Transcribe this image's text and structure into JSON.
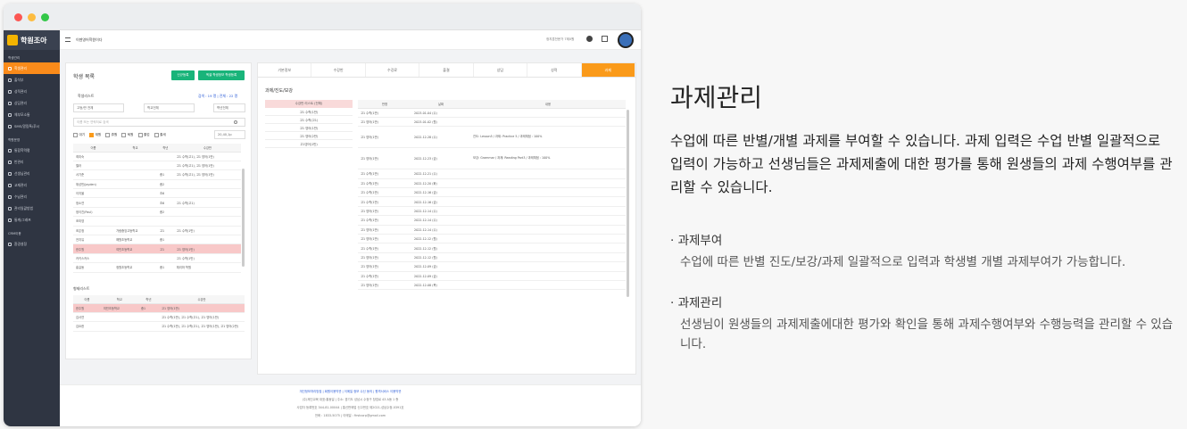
{
  "app": {
    "logo": "학원조아",
    "academy_name": "이젠영어학원이다",
    "top_right": "정지훈전문가 7제0원"
  },
  "sidebar": {
    "sections": [
      {
        "title": "학생관리",
        "items": [
          "학생관리",
          "출석부",
          "성적관리",
          "상담관리",
          "체부모소통",
          "SMS/알림톡/푸시"
        ]
      },
      {
        "title": "학원운영",
        "items": [
          "통합학력평",
          "반관리",
          "선생님관리",
          "교재관리",
          "수납관리",
          "관리일괄방법",
          "통계/그래프"
        ]
      },
      {
        "title": "CRM이용",
        "items": [
          "환경설정"
        ]
      }
    ]
  },
  "student_list": {
    "title": "학생 목록",
    "btn_new": "신규등록",
    "btn_bulk": "엑셀 학생정보 학생등록",
    "subtitle": "학생리스트",
    "count": "검색 : 19 명 | 전체 : 22 명",
    "filter1": "고등/반 전체",
    "filter2": "학교전체",
    "filter3": "학년전체",
    "search_placeholder": "이름 또는 연락처로 검색",
    "checks": [
      "대기",
      "재원",
      "휴원",
      "퇴원",
      "졸업",
      "졸세"
    ],
    "page_size": "20,40,1p",
    "headers": [
      "이름",
      "학교",
      "학년",
      "수강반"
    ],
    "rows": [
      [
        "최미숙",
        "",
        "",
        "고1 수학(고1), 고1 영어(1반)"
      ],
      [
        "엘라",
        "",
        "",
        "고1 수학(고1), 고1 영어(1반)"
      ],
      [
        "서기준",
        "",
        "중1",
        "고1 수학(고1), 고1 영어(1반)"
      ],
      [
        "위성민(Jayden)",
        "",
        "중2",
        ""
      ],
      [
        "이지을",
        "",
        "초6",
        ""
      ],
      [
        "정소연",
        "",
        "초6",
        "고1 수학(고1)"
      ],
      [
        "정이진(Paul)",
        "",
        "중2",
        ""
      ],
      [
        "조미영",
        "",
        "",
        ""
      ],
      [
        "조은정",
        "가람중앙고등학교",
        "고1",
        "고1 수학(1반)"
      ],
      [
        "전지유",
        "해원초등학교",
        "중1",
        ""
      ],
      [
        "한주원",
        "여민초등학교",
        "고1",
        "고1 영어(1반)"
      ],
      [
        "카키스카스",
        "",
        "",
        "고1 수학(1반)"
      ],
      [
        "홍길동",
        "정원초등학교",
        "중1",
        "체리마 학원"
      ]
    ],
    "highlight_row": 10
  },
  "wait_list": {
    "title": "형제리스트",
    "headers": [
      "이름",
      "학교",
      "학년",
      "수강반"
    ],
    "rows": [
      [
        "한주원",
        "여민초등학교",
        "중1",
        "고1 영어(1반)"
      ],
      [
        "김서연",
        "",
        "",
        "고1 수학(1반), 고1 수학(고1), 고1 영어(1반)"
      ],
      [
        "김요한",
        "",
        "",
        "고1 수학(1반), 고1 수학(고1), 고1 영어(1반), 고1 영어(2반)"
      ]
    ]
  },
  "detail": {
    "tabs": [
      "기본정보",
      "수강반",
      "수강료",
      "출결",
      "상담",
      "성적",
      "과제"
    ],
    "active_tab": 6,
    "section_title": "과제/진도/보강",
    "class_list_header": "수강반 리스트 (전체)",
    "class_list": [
      "고1 수학(1반)",
      "고1 수학(고1)",
      "고1 영어(1반)",
      "고1 영어(2반)",
      "고1영어(1반)"
    ],
    "hw_headers": [
      "반명",
      "날짜",
      "내용"
    ],
    "hw_rows": [
      [
        "고1 수학(1반)",
        "2023-01-04 (수)",
        ""
      ],
      [
        "고1 영어(1반)",
        "2023-01-02 (월)",
        ""
      ],
      [
        "고1 영어(1반)",
        "2022-12-28 (수)",
        "진도: Lesson5 / 과제: Practice 5 / 과제채점 : 100%"
      ],
      [
        "고1 영어(1반)",
        "2022-12-23 (금)",
        "보강: Grammar / 과제: Reading Part3 / 과제채점 : 100%"
      ],
      [
        "고1 수학(1반)",
        "2022-12-21 (수)",
        ""
      ],
      [
        "고1 수학(1반)",
        "2022-12-20 (화)",
        ""
      ],
      [
        "고1 수학(1반)",
        "2022-12-16 (금)",
        ""
      ],
      [
        "고1 수학(1반)",
        "2022-12-16 (금)",
        ""
      ],
      [
        "고1 영어(1반)",
        "2022-12-14 (수)",
        ""
      ],
      [
        "고1 수학(1반)",
        "2022-12-14 (수)",
        ""
      ],
      [
        "고1 영어(1반)",
        "2022-12-14 (수)",
        ""
      ],
      [
        "고1 영어(1반)",
        "2022-12-12 (월)",
        ""
      ],
      [
        "고1 수학(1반)",
        "2022-12-12 (월)",
        ""
      ],
      [
        "고1 영어(1반)",
        "2022-12-12 (월)",
        ""
      ],
      [
        "고1 영어(1반)",
        "2022-12-09 (금)",
        ""
      ],
      [
        "고1 수학(1반)",
        "2022-12-09 (금)",
        ""
      ],
      [
        "고1 영어(1반)",
        "2022-12-08 (목)",
        ""
      ]
    ]
  },
  "footer": {
    "links": "개인정보처리방침  |  회원이용약관  |  이메일 정보 수신 동의  |  원격서비스 이용약관",
    "line1": "(주)제인교육 대표:홍동일 | 주소: 경기도 성남시 수정구 창업로 43 A동 1 층",
    "line2": "사업자 등록번호 344-81-00044 | 통신판매업 신고번호 제2021-성남수정-0391호",
    "line3": "전화 : 1833-5075 | 이메일 : firstcorp@gmail.com"
  },
  "feature": {
    "title": "과제관리",
    "description": "수업에 따른 반별/개별 과제를 부여할 수 있습니다. 과제 입력은 수업 반별 일괄적으로 입력이 가능하고 선생님들은 과제제출에 대한 평가를 통해 원생들의 과제 수행여부를 관리할 수 있습니다.",
    "bullets": [
      {
        "title": "과제부여",
        "text": "수업에 따른 반별 진도/보강/과제 일괄적으로 입력과 학생별 개별 과제부여가 가능합니다."
      },
      {
        "title": "과제관리",
        "text": "선생님이 원생들의 과제제출에대한 평가와 확인을 통해 과제수행여부와 수행능력을 관리할 수 있습니다."
      }
    ]
  },
  "colors": {
    "accent": "#fa9a1a",
    "green": "#19b47a",
    "sidebar": "#2f3542"
  }
}
